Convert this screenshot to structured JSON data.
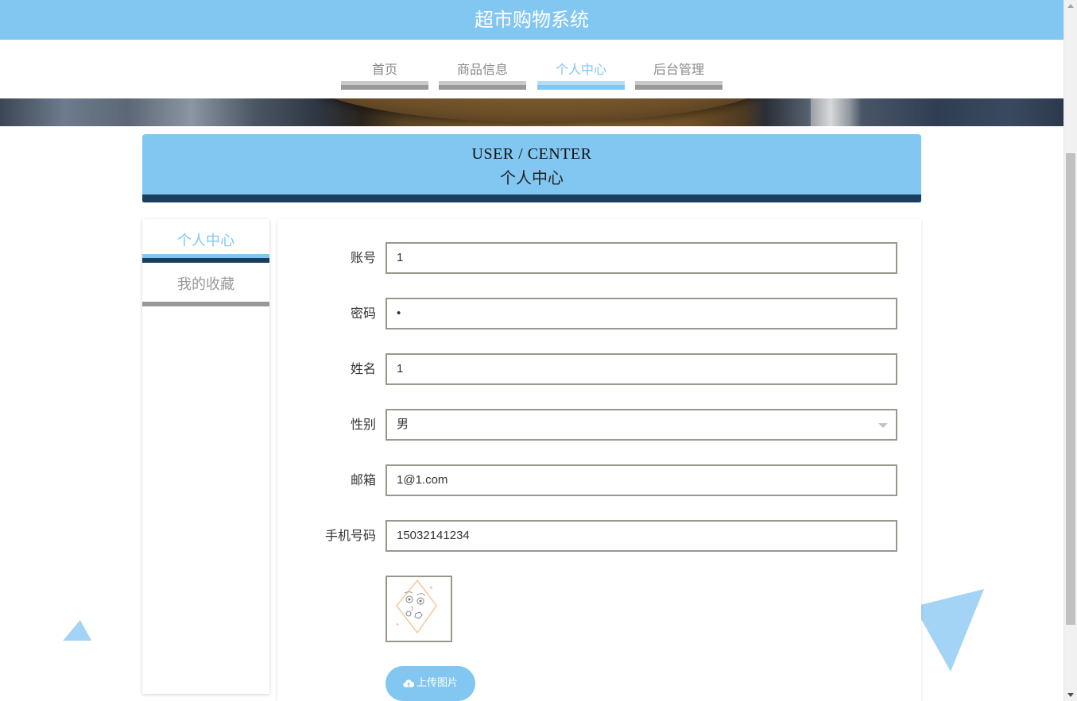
{
  "header": {
    "title": "超市购物系统"
  },
  "nav": {
    "items": [
      {
        "label": "首页",
        "active": false
      },
      {
        "label": "商品信息",
        "active": false
      },
      {
        "label": "个人中心",
        "active": true
      },
      {
        "label": "后台管理",
        "active": false
      }
    ]
  },
  "section": {
    "title_en": "USER / CENTER",
    "title_cn": "个人中心"
  },
  "sidebar": {
    "items": [
      {
        "label": "个人中心",
        "active": true
      },
      {
        "label": "我的收藏",
        "active": false
      }
    ]
  },
  "form": {
    "account": {
      "label": "账号",
      "value": "1"
    },
    "password": {
      "label": "密码",
      "value": "•"
    },
    "name": {
      "label": "姓名",
      "value": "1"
    },
    "gender": {
      "label": "性别",
      "value": "男"
    },
    "email": {
      "label": "邮箱",
      "value": "1@1.com"
    },
    "phone": {
      "label": "手机号码",
      "value": "15032141234"
    },
    "upload_label": "上传图片"
  },
  "colors": {
    "primary": "#82c6f2",
    "dark": "#1a3f5e",
    "border": "#98988c"
  }
}
